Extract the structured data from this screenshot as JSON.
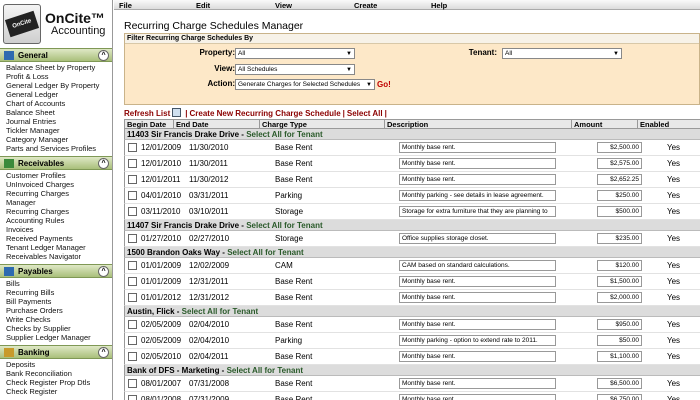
{
  "app": {
    "logo_badge": "OnCite",
    "logo_name": "OnCite™",
    "logo_sub": "Accounting"
  },
  "menu": [
    "File",
    "Edit",
    "View",
    "Create",
    "Help"
  ],
  "sidebar": {
    "sections": [
      {
        "title": "General",
        "icon": "gear-icon",
        "items": [
          "Balance Sheet by Property",
          "Profit & Loss",
          "General Ledger By Property",
          "General Ledger",
          "Chart of Accounts",
          "Balance Sheet",
          "Journal Entries",
          "Tickler Manager",
          "Category Manager",
          "Parts and Services Profiles"
        ]
      },
      {
        "title": "Receivables",
        "icon": "receivables-icon",
        "items": [
          "Customer Profiles",
          "UnInvoiced Charges",
          "Recurring Charges",
          "Manager",
          "Recurring Charges",
          "Accounting Rules",
          "Invoices",
          "Received Payments",
          "Tenant Ledger Manager",
          "Receivables Navigator"
        ]
      },
      {
        "title": "Payables",
        "icon": "payables-icon",
        "items": [
          "Bills",
          "Recurring Bills",
          "Bill Payments",
          "Purchase Orders",
          "Write Checks",
          "Checks by Supplier",
          "Supplier Ledger Manager"
        ]
      },
      {
        "title": "Banking",
        "icon": "banking-icon",
        "items": [
          "Deposits",
          "Bank Reconciliation",
          "Check Register Prop Dtls",
          "Check Register"
        ]
      }
    ]
  },
  "page": {
    "title": "Recurring Charge Schedules Manager"
  },
  "filter": {
    "title": "Filter Recurring Charge Schedules By",
    "property_label": "Property:",
    "property_value": "All",
    "tenant_label": "Tenant:",
    "tenant_value": "All",
    "view_label": "View:",
    "view_value": "All Schedules",
    "action_label": "Action:",
    "action_value": "Generate Charges for Selected Schedules",
    "go": "Go!"
  },
  "links": {
    "refresh": "Refresh List",
    "create": "Create New Recurring Charge Schedule",
    "select_all": "Select All"
  },
  "table": {
    "headers": [
      "Begin Date",
      "End Date",
      "Charge Type",
      "Description",
      "Amount",
      "Enabled"
    ],
    "select_all_text": "Select All for Tenant",
    "groups": [
      {
        "name": "11403 Sir Francis Drake Drive",
        "rows": [
          {
            "begin": "12/01/2009",
            "end": "11/30/2010",
            "type": "Base Rent",
            "desc": "Monthly base rent.",
            "amount": "$2,500.00",
            "enabled": "Yes"
          },
          {
            "begin": "12/01/2010",
            "end": "11/30/2011",
            "type": "Base Rent",
            "desc": "Monthly base rent.",
            "amount": "$2,575.00",
            "enabled": "Yes"
          },
          {
            "begin": "12/01/2011",
            "end": "11/30/2012",
            "type": "Base Rent",
            "desc": "Monthly base rent.",
            "amount": "$2,652.25",
            "enabled": "Yes"
          },
          {
            "begin": "04/01/2010",
            "end": "03/31/2011",
            "type": "Parking",
            "desc": "Monthly parking - see details in lease agreement.",
            "amount": "$250.00",
            "enabled": "Yes"
          },
          {
            "begin": "03/11/2010",
            "end": "03/10/2011",
            "type": "Storage",
            "desc": "Storage for extra furniture that they are planning to",
            "amount": "$500.00",
            "enabled": "Yes"
          }
        ]
      },
      {
        "name": "11407 Sir Francis Drake Drive",
        "rows": [
          {
            "begin": "01/27/2010",
            "end": "02/27/2010",
            "type": "Storage",
            "desc": "Office supplies storage closet.",
            "amount": "$235.00",
            "enabled": "Yes"
          }
        ]
      },
      {
        "name": "1500 Brandon Oaks Way",
        "rows": [
          {
            "begin": "01/01/2009",
            "end": "12/02/2009",
            "type": "CAM",
            "desc": "CAM based on standard calculations.",
            "amount": "$120.00",
            "enabled": "Yes"
          },
          {
            "begin": "01/01/2009",
            "end": "12/31/2011",
            "type": "Base Rent",
            "desc": "Monthly base rent.",
            "amount": "$1,500.00",
            "enabled": "Yes"
          },
          {
            "begin": "01/01/2012",
            "end": "12/31/2012",
            "type": "Base Rent",
            "desc": "Monthly base rent.",
            "amount": "$2,000.00",
            "enabled": "Yes"
          }
        ]
      },
      {
        "name": "Austin, Flick",
        "rows": [
          {
            "begin": "02/05/2009",
            "end": "02/04/2010",
            "type": "Base Rent",
            "desc": "Monthly base rent.",
            "amount": "$950.00",
            "enabled": "Yes"
          },
          {
            "begin": "02/05/2009",
            "end": "02/04/2010",
            "type": "Parking",
            "desc": "Monthly parking - option to extend rate to 2011.",
            "amount": "$50.00",
            "enabled": "Yes"
          },
          {
            "begin": "02/05/2010",
            "end": "02/04/2011",
            "type": "Base Rent",
            "desc": "Monthly base rent.",
            "amount": "$1,100.00",
            "enabled": "Yes"
          }
        ]
      },
      {
        "name": "Bank of DFS - Marketing",
        "rows": [
          {
            "begin": "08/01/2007",
            "end": "07/31/2008",
            "type": "Base Rent",
            "desc": "Monthly base rent.",
            "amount": "$6,500.00",
            "enabled": "Yes"
          },
          {
            "begin": "08/01/2008",
            "end": "07/31/2009",
            "type": "Base Rent",
            "desc": "Monthly base rent.",
            "amount": "$6,750.00",
            "enabled": "Yes"
          }
        ]
      }
    ]
  },
  "colors": {
    "accent_green": "#a9bf7a",
    "filter_bg": "#fde8c8",
    "link_red": "#8b0000"
  }
}
